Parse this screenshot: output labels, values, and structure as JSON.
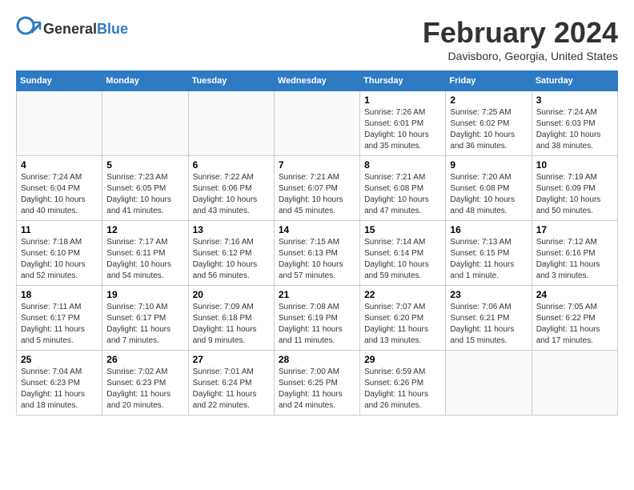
{
  "header": {
    "logo_general": "General",
    "logo_blue": "Blue",
    "title": "February 2024",
    "subtitle": "Davisboro, Georgia, United States"
  },
  "days_of_week": [
    "Sunday",
    "Monday",
    "Tuesday",
    "Wednesday",
    "Thursday",
    "Friday",
    "Saturday"
  ],
  "weeks": [
    {
      "days": [
        {
          "num": "",
          "empty": true
        },
        {
          "num": "",
          "empty": true
        },
        {
          "num": "",
          "empty": true
        },
        {
          "num": "",
          "empty": true
        },
        {
          "num": "1",
          "sunrise": "7:26 AM",
          "sunset": "6:01 PM",
          "daylight": "10 hours and 35 minutes."
        },
        {
          "num": "2",
          "sunrise": "7:25 AM",
          "sunset": "6:02 PM",
          "daylight": "10 hours and 36 minutes."
        },
        {
          "num": "3",
          "sunrise": "7:24 AM",
          "sunset": "6:03 PM",
          "daylight": "10 hours and 38 minutes."
        }
      ]
    },
    {
      "days": [
        {
          "num": "4",
          "sunrise": "7:24 AM",
          "sunset": "6:04 PM",
          "daylight": "10 hours and 40 minutes."
        },
        {
          "num": "5",
          "sunrise": "7:23 AM",
          "sunset": "6:05 PM",
          "daylight": "10 hours and 41 minutes."
        },
        {
          "num": "6",
          "sunrise": "7:22 AM",
          "sunset": "6:06 PM",
          "daylight": "10 hours and 43 minutes."
        },
        {
          "num": "7",
          "sunrise": "7:21 AM",
          "sunset": "6:07 PM",
          "daylight": "10 hours and 45 minutes."
        },
        {
          "num": "8",
          "sunrise": "7:21 AM",
          "sunset": "6:08 PM",
          "daylight": "10 hours and 47 minutes."
        },
        {
          "num": "9",
          "sunrise": "7:20 AM",
          "sunset": "6:08 PM",
          "daylight": "10 hours and 48 minutes."
        },
        {
          "num": "10",
          "sunrise": "7:19 AM",
          "sunset": "6:09 PM",
          "daylight": "10 hours and 50 minutes."
        }
      ]
    },
    {
      "days": [
        {
          "num": "11",
          "sunrise": "7:18 AM",
          "sunset": "6:10 PM",
          "daylight": "10 hours and 52 minutes."
        },
        {
          "num": "12",
          "sunrise": "7:17 AM",
          "sunset": "6:11 PM",
          "daylight": "10 hours and 54 minutes."
        },
        {
          "num": "13",
          "sunrise": "7:16 AM",
          "sunset": "6:12 PM",
          "daylight": "10 hours and 56 minutes."
        },
        {
          "num": "14",
          "sunrise": "7:15 AM",
          "sunset": "6:13 PM",
          "daylight": "10 hours and 57 minutes."
        },
        {
          "num": "15",
          "sunrise": "7:14 AM",
          "sunset": "6:14 PM",
          "daylight": "10 hours and 59 minutes."
        },
        {
          "num": "16",
          "sunrise": "7:13 AM",
          "sunset": "6:15 PM",
          "daylight": "11 hours and 1 minute."
        },
        {
          "num": "17",
          "sunrise": "7:12 AM",
          "sunset": "6:16 PM",
          "daylight": "11 hours and 3 minutes."
        }
      ]
    },
    {
      "days": [
        {
          "num": "18",
          "sunrise": "7:11 AM",
          "sunset": "6:17 PM",
          "daylight": "11 hours and 5 minutes."
        },
        {
          "num": "19",
          "sunrise": "7:10 AM",
          "sunset": "6:17 PM",
          "daylight": "11 hours and 7 minutes."
        },
        {
          "num": "20",
          "sunrise": "7:09 AM",
          "sunset": "6:18 PM",
          "daylight": "11 hours and 9 minutes."
        },
        {
          "num": "21",
          "sunrise": "7:08 AM",
          "sunset": "6:19 PM",
          "daylight": "11 hours and 11 minutes."
        },
        {
          "num": "22",
          "sunrise": "7:07 AM",
          "sunset": "6:20 PM",
          "daylight": "11 hours and 13 minutes."
        },
        {
          "num": "23",
          "sunrise": "7:06 AM",
          "sunset": "6:21 PM",
          "daylight": "11 hours and 15 minutes."
        },
        {
          "num": "24",
          "sunrise": "7:05 AM",
          "sunset": "6:22 PM",
          "daylight": "11 hours and 17 minutes."
        }
      ]
    },
    {
      "days": [
        {
          "num": "25",
          "sunrise": "7:04 AM",
          "sunset": "6:23 PM",
          "daylight": "11 hours and 18 minutes."
        },
        {
          "num": "26",
          "sunrise": "7:02 AM",
          "sunset": "6:23 PM",
          "daylight": "11 hours and 20 minutes."
        },
        {
          "num": "27",
          "sunrise": "7:01 AM",
          "sunset": "6:24 PM",
          "daylight": "11 hours and 22 minutes."
        },
        {
          "num": "28",
          "sunrise": "7:00 AM",
          "sunset": "6:25 PM",
          "daylight": "11 hours and 24 minutes."
        },
        {
          "num": "29",
          "sunrise": "6:59 AM",
          "sunset": "6:26 PM",
          "daylight": "11 hours and 26 minutes."
        },
        {
          "num": "",
          "empty": true
        },
        {
          "num": "",
          "empty": true
        }
      ]
    }
  ]
}
